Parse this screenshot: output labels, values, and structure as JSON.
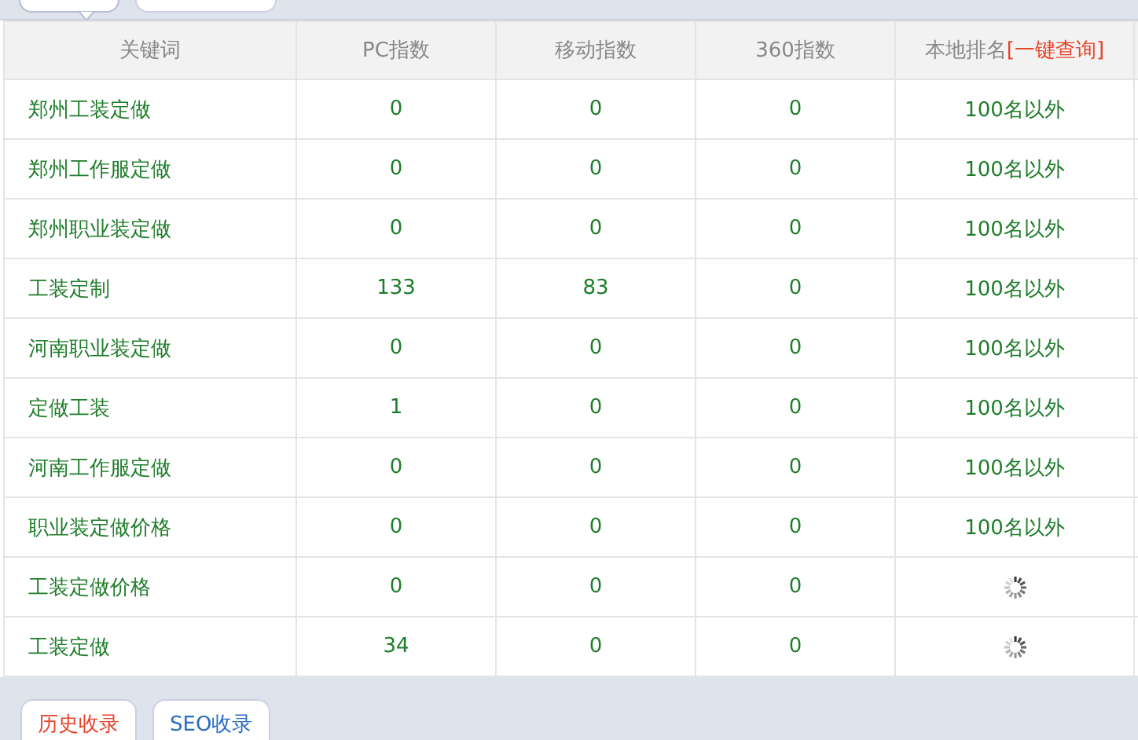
{
  "top_tabs": [
    {
      "selected": true
    },
    {
      "selected": false
    }
  ],
  "table": {
    "columns": [
      {
        "label": "关键词"
      },
      {
        "label": "PC指数"
      },
      {
        "label": "移动指数"
      },
      {
        "label": "360指数"
      },
      {
        "label": "本地排名",
        "link": "[一键查询]"
      }
    ],
    "rows": [
      {
        "keyword": "郑州工装定做",
        "pc": "0",
        "mobile": "0",
        "index360": "0",
        "rank": {
          "kind": "text",
          "text": "100名以外"
        }
      },
      {
        "keyword": "郑州工作服定做",
        "pc": "0",
        "mobile": "0",
        "index360": "0",
        "rank": {
          "kind": "text",
          "text": "100名以外"
        }
      },
      {
        "keyword": "郑州职业装定做",
        "pc": "0",
        "mobile": "0",
        "index360": "0",
        "rank": {
          "kind": "text",
          "text": "100名以外"
        }
      },
      {
        "keyword": "工装定制",
        "pc": "133",
        "mobile": "83",
        "index360": "0",
        "rank": {
          "kind": "text",
          "text": "100名以外"
        }
      },
      {
        "keyword": "河南职业装定做",
        "pc": "0",
        "mobile": "0",
        "index360": "0",
        "rank": {
          "kind": "text",
          "text": "100名以外"
        }
      },
      {
        "keyword": "定做工装",
        "pc": "1",
        "mobile": "0",
        "index360": "0",
        "rank": {
          "kind": "text",
          "text": "100名以外"
        }
      },
      {
        "keyword": "河南工作服定做",
        "pc": "0",
        "mobile": "0",
        "index360": "0",
        "rank": {
          "kind": "text",
          "text": "100名以外"
        }
      },
      {
        "keyword": "职业装定做价格",
        "pc": "0",
        "mobile": "0",
        "index360": "0",
        "rank": {
          "kind": "text",
          "text": "100名以外"
        }
      },
      {
        "keyword": "工装定做价格",
        "pc": "0",
        "mobile": "0",
        "index360": "0",
        "rank": {
          "kind": "loading"
        }
      },
      {
        "keyword": "工装定做",
        "pc": "34",
        "mobile": "0",
        "index360": "0",
        "rank": {
          "kind": "loading"
        }
      }
    ]
  },
  "bottom_tabs": [
    {
      "label": "历史收录",
      "selected": true
    },
    {
      "label": "SEO收录",
      "selected": false
    }
  ]
}
